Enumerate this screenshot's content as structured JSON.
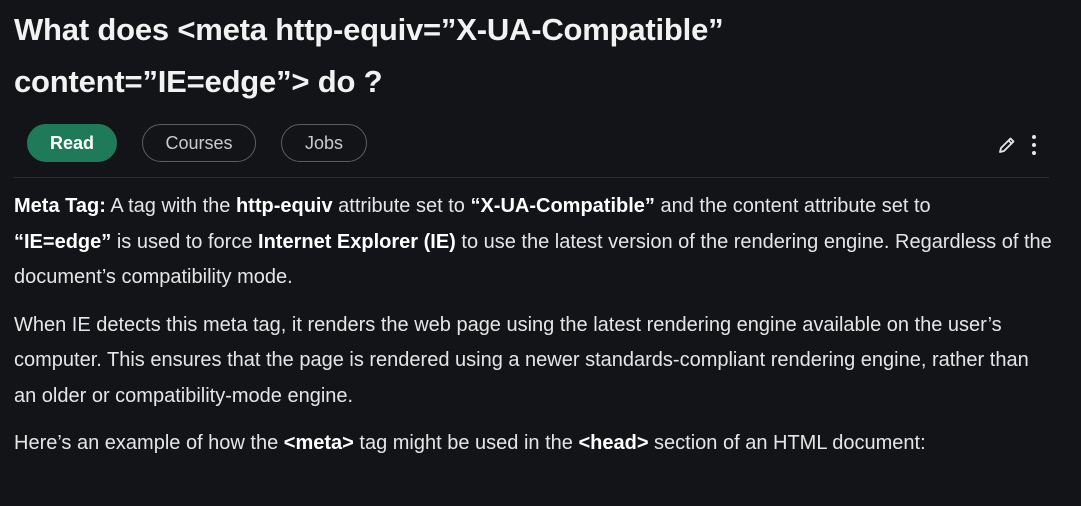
{
  "article": {
    "title": "What does <meta http-equiv=”X-UA-Compatible” content=”IE=edge”> do ?"
  },
  "tabs": [
    {
      "label": "Read",
      "active": true
    },
    {
      "label": "Courses",
      "active": false
    },
    {
      "label": "Jobs",
      "active": false
    }
  ],
  "toolbar": {
    "edit_icon": "pencil-icon",
    "more_icon": "vertical-dots-icon"
  },
  "paragraphs": {
    "p1": {
      "term_label": "Meta Tag:",
      "t1": " A tag with the ",
      "b1": "http-equiv",
      "t2": " attribute set to ",
      "b2": "“X-UA-Compatible”",
      "t3": " and the content attribute set to ",
      "b3": "“IE=edge”",
      "t4": " is used to force ",
      "b4": "Internet Explorer (IE)",
      "t5": " to use the latest version of the rendering engine. Regardless of the document’s compatibility mode."
    },
    "p2": {
      "text": "When IE detects this meta tag, it renders the web page using the latest rendering engine available on the user’s computer. This ensures that the page is rendered using a newer standards-compliant rendering engine, rather than an older or compatibility-mode engine."
    },
    "p3": {
      "t1": "Here’s an example of how the ",
      "b1": "<meta>",
      "t2": " tag might be used in the ",
      "b2": "<head>",
      "t3": " section of an HTML document:"
    }
  },
  "colors": {
    "background": "#131417",
    "accent": "#1f7a5a",
    "text": "#e6e6e6"
  }
}
